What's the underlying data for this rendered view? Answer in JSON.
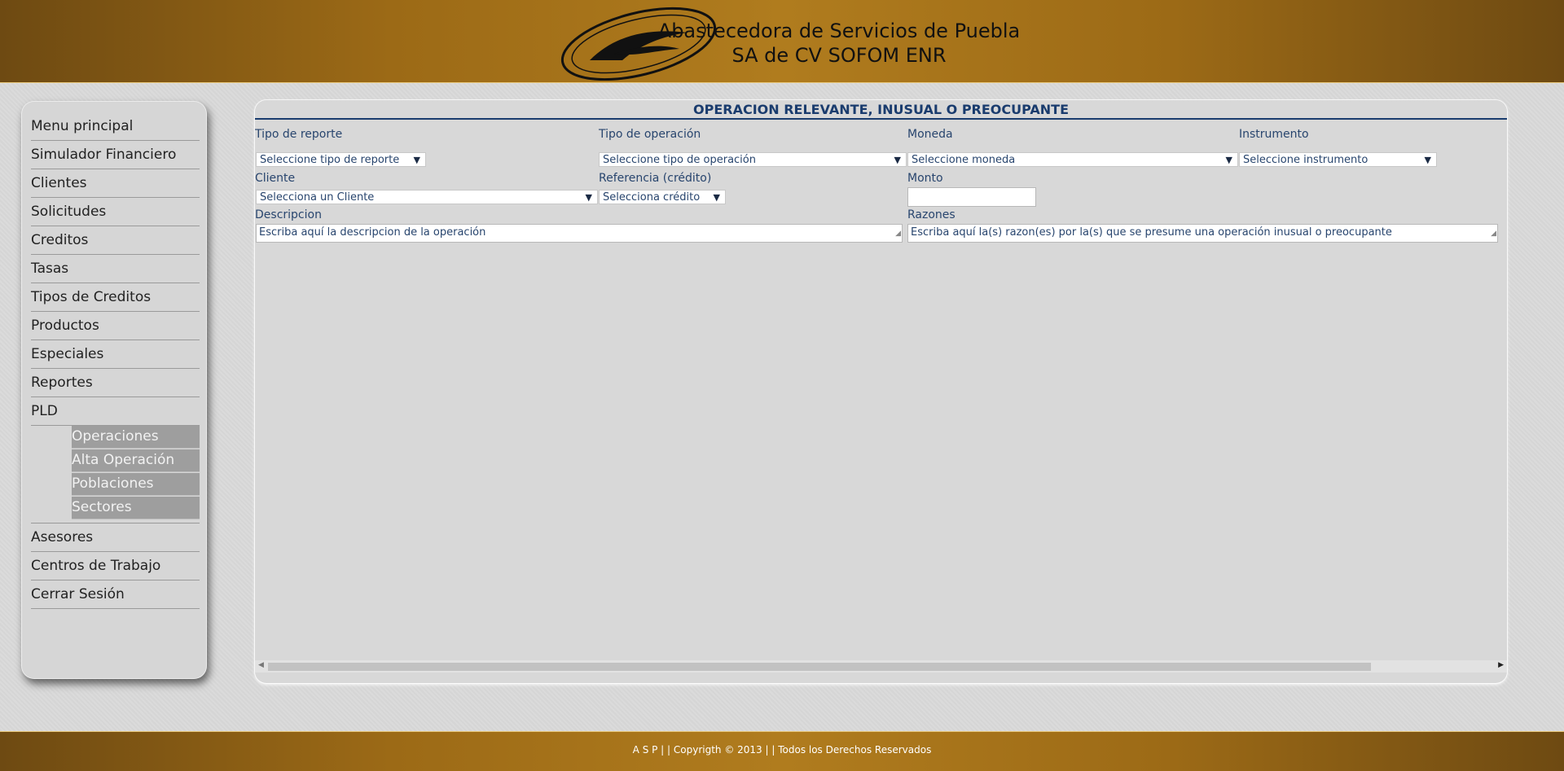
{
  "header": {
    "company_line1": "Abastecedora de Servicios de Puebla",
    "company_line2": "SA de CV SOFOM ENR"
  },
  "sidebar": {
    "items": [
      {
        "label": "Menu principal"
      },
      {
        "label": "Simulador Financiero"
      },
      {
        "label": "Clientes"
      },
      {
        "label": "Solicitudes"
      },
      {
        "label": "Creditos"
      },
      {
        "label": "Tasas"
      },
      {
        "label": "Tipos de Creditos"
      },
      {
        "label": "Productos"
      },
      {
        "label": "Especiales"
      },
      {
        "label": "Reportes"
      },
      {
        "label": "PLD"
      }
    ],
    "pld_submenu": [
      {
        "label": "Operaciones"
      },
      {
        "label": "Alta Operación"
      },
      {
        "label": "Poblaciones"
      },
      {
        "label": "Sectores"
      }
    ],
    "items_after": [
      {
        "label": "Asesores"
      },
      {
        "label": "Centros de Trabajo"
      },
      {
        "label": "Cerrar Sesión"
      }
    ]
  },
  "form": {
    "title": "OPERACION RELEVANTE, INUSUAL O PREOCUPANTE",
    "tipo_reporte": {
      "label": "Tipo de reporte",
      "value": "Seleccione tipo de reporte"
    },
    "tipo_operacion": {
      "label": "Tipo de operación",
      "value": "Seleccione tipo de operación"
    },
    "moneda": {
      "label": "Moneda",
      "value": "Seleccione moneda"
    },
    "instrumento": {
      "label": "Instrumento",
      "value": "Seleccione instrumento"
    },
    "cliente": {
      "label": "Cliente",
      "value": "Selecciona un Cliente"
    },
    "referencia": {
      "label": "Referencia (crédito)",
      "value": "Selecciona crédito"
    },
    "monto": {
      "label": "Monto",
      "value": ""
    },
    "descripcion": {
      "label": "Descripcion",
      "placeholder": "Escriba aquí la descripcion de la operación"
    },
    "razones": {
      "label": "Razones",
      "placeholder": "Escriba aquí la(s) razon(es) por la(s) que se presume una operación inusual o preocupante"
    }
  },
  "footer": {
    "text": "A S P  | |  Copyrigth © 2013  | |  Todos los Derechos Reservados"
  },
  "icons": {
    "dropdown": "triangle-down",
    "scroll_left": "triangle-left",
    "scroll_right": "triangle-right",
    "resize": "resize-grip"
  },
  "colors": {
    "header_gold": "#b07c1e",
    "title_blue": "#1a3c6e",
    "submenu_bg": "#9e9e9e"
  }
}
